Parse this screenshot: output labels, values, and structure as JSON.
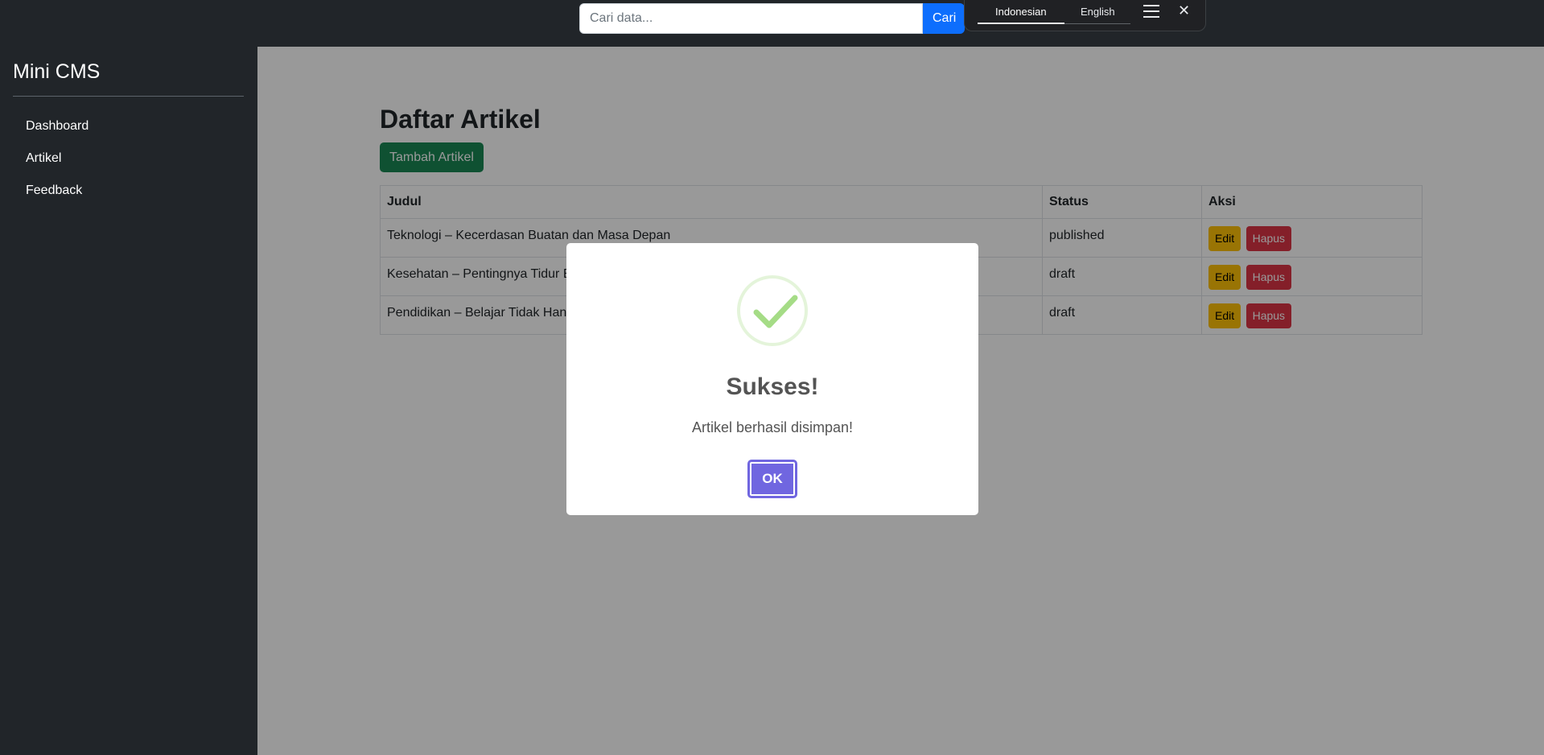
{
  "search": {
    "placeholder": "Cari data...",
    "button_label": "Cari"
  },
  "translate_bar": {
    "languages": [
      "Indonesian",
      "English"
    ],
    "active": "Indonesian",
    "menu_icon": "hamburger-menu-icon",
    "close_icon": "close-icon",
    "close_glyph": "✕"
  },
  "sidebar": {
    "brand": "Mini CMS",
    "items": [
      {
        "label": "Dashboard"
      },
      {
        "label": "Artikel"
      },
      {
        "label": "Feedback"
      }
    ]
  },
  "main": {
    "title": "Daftar Artikel",
    "add_button": "Tambah Artikel",
    "table": {
      "headers": [
        "Judul",
        "Status",
        "Aksi"
      ],
      "rows": [
        {
          "judul": "Teknologi – Kecerdasan Buatan dan Masa Depan",
          "status": "published",
          "edit": "Edit",
          "hapus": "Hapus"
        },
        {
          "judul": "Kesehatan – Pentingnya Tidur B",
          "status": "draft",
          "edit": "Edit",
          "hapus": "Hapus"
        },
        {
          "judul": "Pendidikan – Belajar Tidak Hany",
          "status": "draft",
          "edit": "Edit",
          "hapus": "Hapus"
        }
      ]
    }
  },
  "modal": {
    "icon": "success-check-icon",
    "title": "Sukses!",
    "text": "Artikel berhasil disimpan!",
    "ok_label": "OK"
  },
  "colors": {
    "primary": "#0d6efd",
    "success": "#198754",
    "warning": "#ffc107",
    "danger": "#dc3545",
    "modal_confirm": "#7066e0",
    "check": "#a5dc86",
    "dark": "#212529"
  }
}
